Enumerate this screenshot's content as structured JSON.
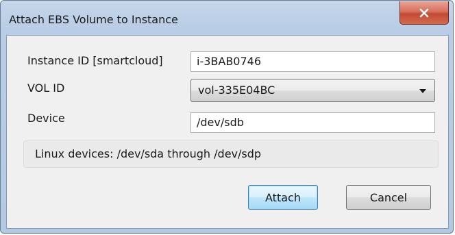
{
  "window": {
    "title": "Attach EBS Volume to Instance",
    "close_symbol": "x"
  },
  "form": {
    "instance_id_label": "Instance ID [smartcloud]",
    "instance_id_value": "i-3BAB0746",
    "vol_id_label": "VOL ID",
    "vol_id_selected": "vol-335E04BC",
    "device_label": "Device",
    "device_value": "/dev/sdb"
  },
  "info": {
    "text": "Linux devices: /dev/sda through /dev/sdp"
  },
  "buttons": {
    "attach_label": "Attach",
    "cancel_label": "Cancel"
  },
  "icons": {
    "close": "close-icon",
    "dropdown": "chevron-down-icon"
  },
  "colors": {
    "close_button": "#c34a33",
    "default_button_border": "#3c7fb1",
    "window_frame": "#b9cde6"
  }
}
